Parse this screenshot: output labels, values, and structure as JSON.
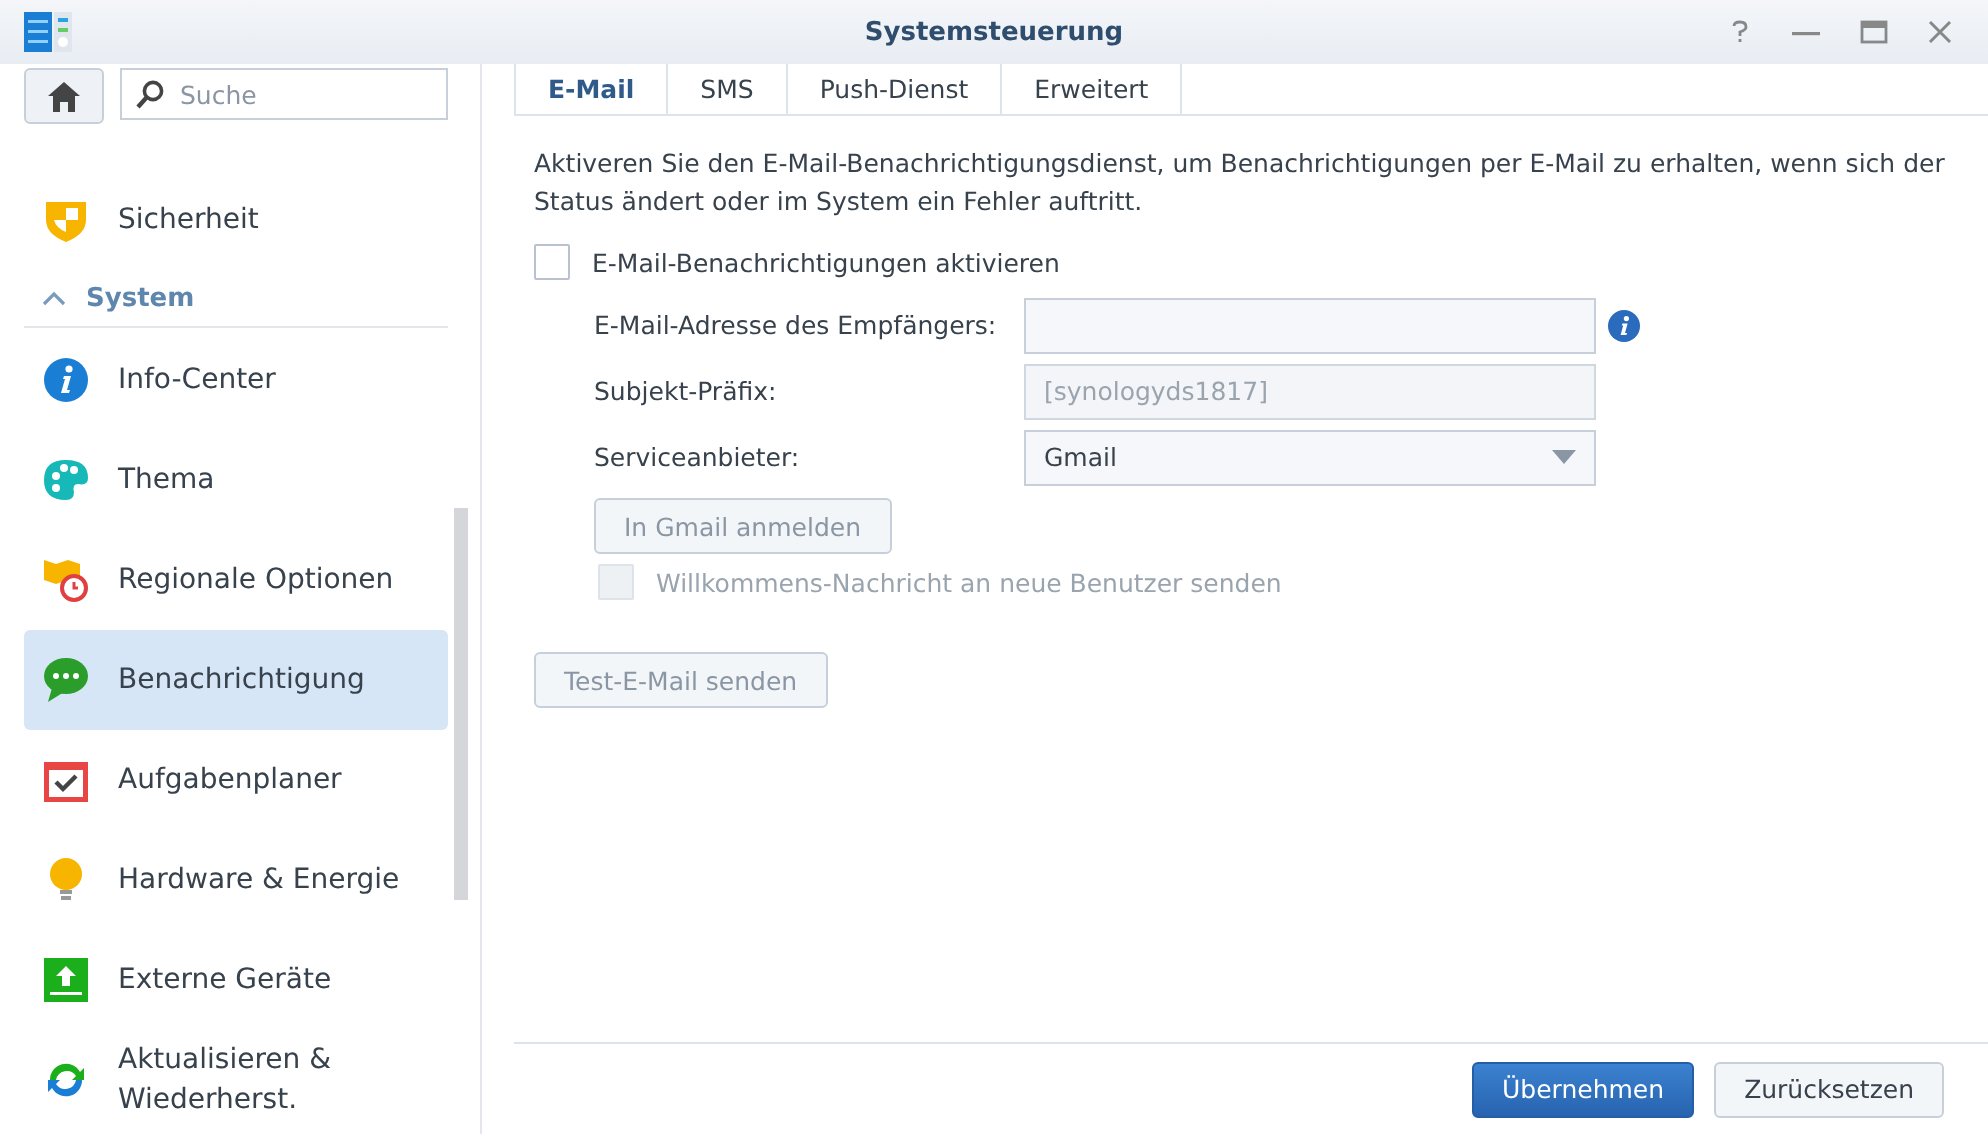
{
  "window": {
    "title": "Systemsteuerung"
  },
  "search": {
    "placeholder": "Suche"
  },
  "sidebar": {
    "items": [
      {
        "kind": "item",
        "label": "Sicherheit",
        "selected": false
      },
      {
        "kind": "section",
        "label": "System",
        "expanded": true
      },
      {
        "kind": "item",
        "label": "Info-Center",
        "selected": false
      },
      {
        "kind": "item",
        "label": "Thema",
        "selected": false
      },
      {
        "kind": "item",
        "label": "Regionale Optionen",
        "selected": false
      },
      {
        "kind": "item",
        "label": "Benachrichtigung",
        "selected": true
      },
      {
        "kind": "item",
        "label": "Aufgabenplaner",
        "selected": false
      },
      {
        "kind": "item",
        "label": "Hardware & Energie",
        "selected": false
      },
      {
        "kind": "item",
        "label": "Externe Geräte",
        "selected": false
      },
      {
        "kind": "item",
        "label": "Aktualisieren & Wiederherst.",
        "selected": false
      }
    ]
  },
  "tabs": [
    {
      "label": "E-Mail",
      "selected": true
    },
    {
      "label": "SMS",
      "selected": false
    },
    {
      "label": "Push-Dienst",
      "selected": false
    },
    {
      "label": "Erweitert",
      "selected": false
    }
  ],
  "description": "Aktiveren Sie den E-Mail-Benachrichtigungsdienst, um Benachrichtigungen per E-Mail zu erhalten, wenn sich der Status ändert oder im System ein Fehler auftritt.",
  "enable_checkbox": {
    "label": "E-Mail-Benachrichtigungen aktivieren",
    "checked": false,
    "disabled": false
  },
  "fields": [
    {
      "kind": "text",
      "label": "E-Mail-Adresse des Empfängers:",
      "disabled": false,
      "info": true
    },
    {
      "kind": "text",
      "label": "Subjekt-Präfix:",
      "value": "[synologyds1817]",
      "disabled": true,
      "info": false
    },
    {
      "kind": "select",
      "label": "Serviceanbieter:",
      "value": "Gmail",
      "disabled": false,
      "info": false
    }
  ],
  "login_button": {
    "label": "In Gmail anmelden",
    "disabled": true
  },
  "welcome_checkbox": {
    "label": "Willkommens-Nachricht an neue Benutzer senden",
    "checked": false,
    "disabled": true
  },
  "test_button": {
    "label": "Test-E-Mail senden",
    "disabled": true
  },
  "footer_buttons": [
    {
      "label": "Übernehmen",
      "kind": "primary"
    },
    {
      "label": "Zurücksetzen",
      "kind": "secondary"
    }
  ]
}
